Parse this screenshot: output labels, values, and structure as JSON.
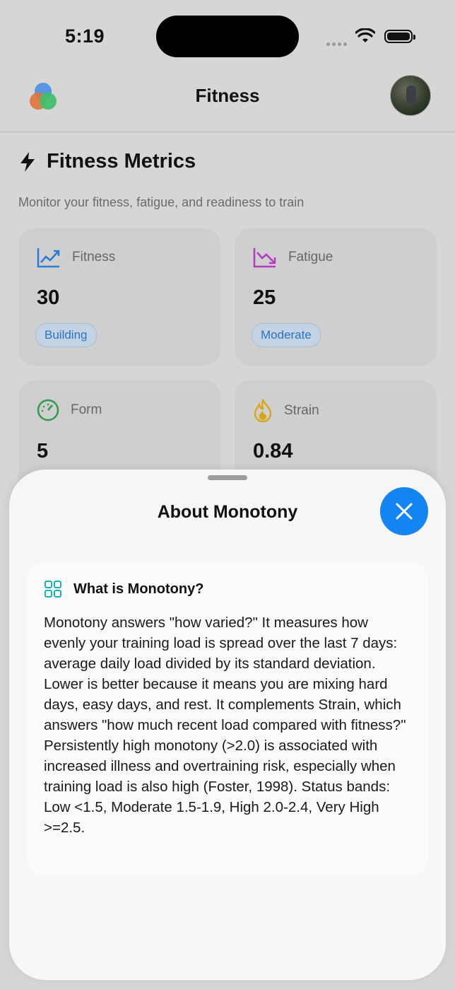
{
  "status_bar": {
    "time": "5:19"
  },
  "header": {
    "title": "Fitness"
  },
  "page": {
    "title": "Fitness Metrics",
    "subtitle": "Monitor your fitness, fatigue, and readiness to train"
  },
  "cards": [
    {
      "label": "Fitness",
      "value": "30",
      "badge": "Building",
      "icon": "trend-up-icon",
      "color": "#2a7ad6"
    },
    {
      "label": "Fatigue",
      "value": "25",
      "badge": "Moderate",
      "icon": "trend-down-icon",
      "color": "#b43ac0"
    },
    {
      "label": "Form",
      "value": "5",
      "icon": "gauge-icon",
      "color": "#2e9a4a"
    },
    {
      "label": "Strain",
      "value": "0.84",
      "icon": "flame-icon",
      "color": "#d8a514"
    }
  ],
  "sheet": {
    "title": "About Monotony",
    "card_title": "What is Monotony?",
    "body": "Monotony answers \"how varied?\" It measures how evenly your training load is spread over the last 7 days: average daily load divided by its standard deviation. Lower is better because it means you are mixing hard days, easy days, and rest. It complements Strain, which answers \"how much recent load compared with fitness?\" Persistently high monotony (>2.0) is associated with increased illness and overtraining risk, especially when training load is also high (Foster, 1998). Status bands: Low <1.5, Moderate 1.5-1.9, High 2.0-2.4, Very High >=2.5."
  },
  "colors": {
    "accent": "#1485f5"
  }
}
